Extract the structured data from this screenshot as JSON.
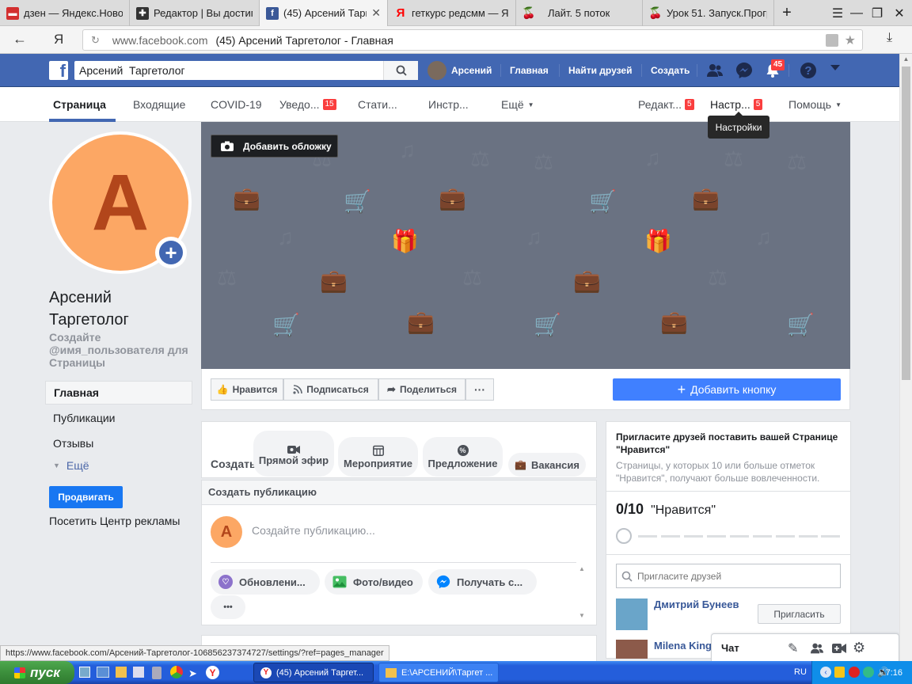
{
  "browser": {
    "tabs": [
      {
        "title": "дзен — Яндекс.Новос",
        "icon": "yandex-news-icon",
        "color": "#d32f2f"
      },
      {
        "title": "Редактор | Вы достиг",
        "icon": "editor-icon",
        "color": "#333333"
      },
      {
        "title": "(45) Арсений Тарг",
        "icon": "facebook-icon",
        "color": "#3b5998",
        "active": true
      },
      {
        "title": "геткурс редсмм — Ян",
        "icon": "yandex-icon",
        "color": "#ff0000"
      },
      {
        "title": "Лайт. 5 поток",
        "icon": "cherry-icon",
        "color": "#c62828"
      },
      {
        "title": "Урок 51. Запуск.Прогр",
        "icon": "cherry-icon",
        "color": "#c62828"
      }
    ],
    "address_domain": "www.facebook.com",
    "address_title": "(45) Арсений Таргетолог - Главная",
    "yandex_letter": "Я"
  },
  "fb_header": {
    "search_value": "Арсений  Таргетолог",
    "user_name": "Арсений",
    "nav_home": "Главная",
    "nav_find_friends": "Найти друзей",
    "nav_create": "Создать",
    "notifications_count": "45"
  },
  "page_tabs": {
    "page": "Страница",
    "inbox": "Входящие",
    "covid": "COVID-19",
    "notifications": "Уведо...",
    "notifications_badge": "15",
    "stats": "Стати...",
    "tools": "Инстр...",
    "more": "Ещё",
    "editor": "Редакт...",
    "editor_badge": "5",
    "settings": "Настр...",
    "settings_badge": "5",
    "help": "Помощь",
    "tooltip": "Настройки"
  },
  "left": {
    "avatar_letter": "A",
    "page_name": "Арсений Таргетолог",
    "create_username": "Создайте @имя_пользователя для Страницы",
    "nav": [
      "Главная",
      "Публикации",
      "Отзывы"
    ],
    "more": "Ещё",
    "promote": "Продвигать",
    "ad_center": "Посетить Центр рекламы"
  },
  "cover": {
    "add_cover": "Добавить обложку"
  },
  "actions": {
    "like": "Нравится",
    "follow": "Подписаться",
    "share": "Поделиться",
    "more": "···",
    "add_button": "Добавить кнопку"
  },
  "create_strip": {
    "label": "Создать",
    "live": "Прямой эфир",
    "event": "Мероприятие",
    "offer": "Предложение",
    "job": "Вакансия"
  },
  "composer": {
    "title": "Создать публикацию",
    "avatar_letter": "A",
    "placeholder": "Создайте публикацию...",
    "chips": [
      "Обновлени...",
      "Фото/видео",
      "Получать с..."
    ],
    "more": "•••"
  },
  "invite": {
    "title": "Пригласите друзей поставить вашей Странице \"Нравится\"",
    "description": "Страницы, у которых 10 или больше отметок \"Нравится\", получают больше вовлеченности.",
    "progress_count": "0/10",
    "progress_label": "\"Нравится\"",
    "progress_value": 0,
    "search_placeholder": "Пригласите друзей",
    "friends": [
      {
        "name": "Дмитрий Бунеев",
        "button": "Пригласить"
      },
      {
        "name": "Milena King"
      }
    ]
  },
  "chat": {
    "label": "Чат"
  },
  "status_url": "https://www.facebook.com/Арсений-Таргетолог-106856237374727/settings/?ref=pages_manager",
  "taskbar": {
    "start": "пуск",
    "items": [
      "(45) Арсений Таргет...",
      "E:\\АРСЕНИЙ\\Таргет ..."
    ],
    "lang": "RU",
    "time": "17:16"
  }
}
